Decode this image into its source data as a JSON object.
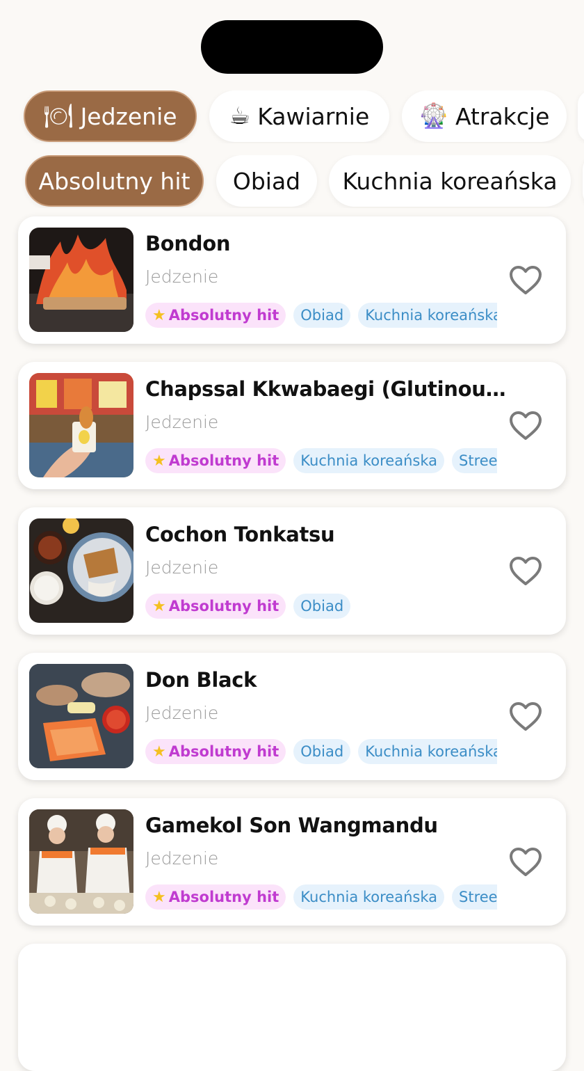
{
  "categories": [
    {
      "icon": "plate-icon",
      "glyph": "🍽",
      "label": "Jedzenie",
      "active": true
    },
    {
      "icon": "coffee-icon",
      "glyph": "☕",
      "label": "Kawiarnie",
      "active": false
    },
    {
      "icon": "ferris-wheel-icon",
      "glyph": "🎡",
      "label": "Atrakcje",
      "active": false
    }
  ],
  "filters": [
    {
      "label": "Absolutny hit",
      "active": true
    },
    {
      "label": "Obiad",
      "active": false
    },
    {
      "label": "Kuchnia koreańska",
      "active": false
    }
  ],
  "places": [
    {
      "title": "Bondon",
      "category": "Jedzenie",
      "hit": "Absolutny hit",
      "tags": [
        "Obiad",
        "Kuchnia koreańska"
      ]
    },
    {
      "title": "Chapssal Kkwabaegi (Glutinous Ri...",
      "category": "Jedzenie",
      "hit": "Absolutny hit",
      "tags": [
        "Kuchnia koreańska",
        "Street-f"
      ]
    },
    {
      "title": "Cochon Tonkatsu",
      "category": "Jedzenie",
      "hit": "Absolutny hit",
      "tags": [
        "Obiad"
      ]
    },
    {
      "title": "Don Black",
      "category": "Jedzenie",
      "hit": "Absolutny hit",
      "tags": [
        "Obiad",
        "Kuchnia koreańska"
      ]
    },
    {
      "title": "Gamekol Son Wangmandu",
      "category": "Jedzenie",
      "hit": "Absolutny hit",
      "tags": [
        "Kuchnia koreańska",
        "Street-f"
      ]
    }
  ],
  "colors": {
    "accent": "#9a6a45",
    "hit_bg": "#fbe3fa",
    "hit_text": "#c03bd0",
    "tag_bg": "#e6f2fc",
    "tag_text": "#3b8dc6",
    "heart": "#7a7a7a"
  }
}
